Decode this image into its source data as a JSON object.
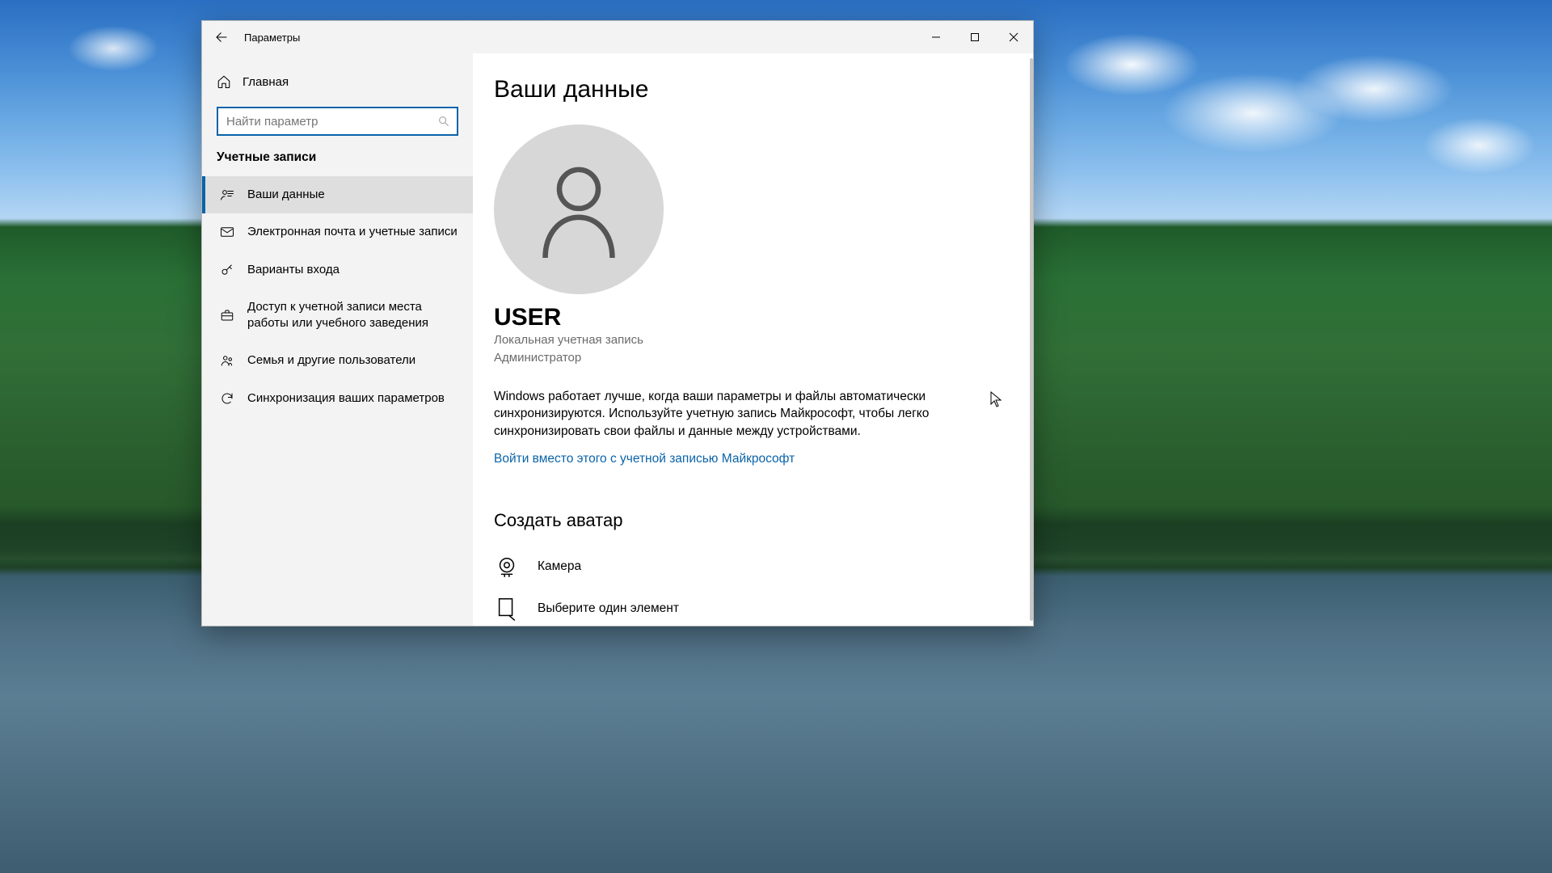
{
  "titlebar": {
    "app_name": "Параметры"
  },
  "sidebar": {
    "home_label": "Главная",
    "category": "Учетные записи",
    "items": [
      {
        "label": "Ваши данные"
      },
      {
        "label": "Электронная почта и учетные записи"
      },
      {
        "label": "Варианты входа"
      },
      {
        "label": "Доступ к учетной записи места работы или учебного заведения"
      },
      {
        "label": "Семья и другие пользователи"
      },
      {
        "label": "Синхронизация ваших параметров"
      }
    ]
  },
  "search": {
    "placeholder": "Найти параметр"
  },
  "main": {
    "heading": "Ваши данные",
    "username": "USER",
    "account_type": "Локальная учетная запись",
    "role": "Администратор",
    "description": "Windows работает лучше, когда ваши параметры и файлы автоматически синхронизируются. Используйте учетную запись Майкрософт, чтобы легко синхронизировать свои файлы и данные между устройствами.",
    "signin_link": "Войти вместо этого с учетной записью Майкрософт",
    "avatar_heading": "Создать аватар",
    "options": [
      {
        "label": "Камера"
      },
      {
        "label": "Выберите один элемент"
      }
    ]
  },
  "colors": {
    "accent": "#0a63a8"
  }
}
